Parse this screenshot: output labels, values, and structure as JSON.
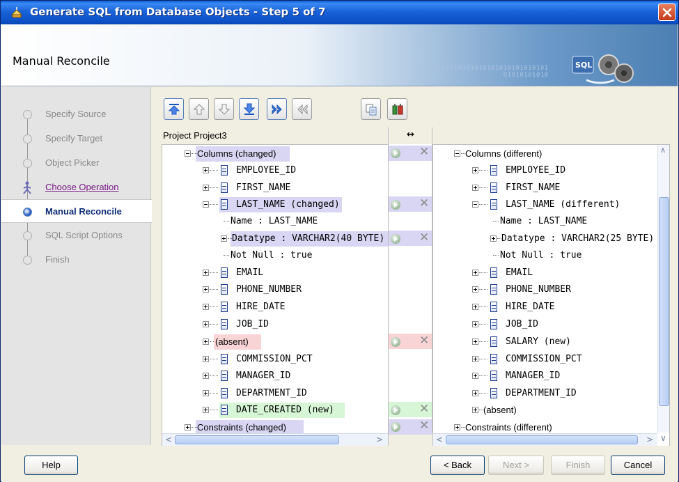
{
  "window": {
    "title": "Generate SQL from Database Objects - Step 5 of 7"
  },
  "header": {
    "heading": "Manual Reconcile",
    "binary_text": "0101010101010101010101010101\n                 01010101010"
  },
  "nav": {
    "items": [
      {
        "label": "Specify Source",
        "state": "done"
      },
      {
        "label": "Specify Target",
        "state": "done"
      },
      {
        "label": "Object Picker",
        "state": "done"
      },
      {
        "label": "Choose Operation",
        "state": "link"
      },
      {
        "label": "Manual Reconcile",
        "state": "active"
      },
      {
        "label": "SQL Script Options",
        "state": "pending"
      },
      {
        "label": "Finish",
        "state": "pending"
      }
    ]
  },
  "toolbar": {
    "buttons": [
      "move-top-icon",
      "move-up-icon",
      "move-down-icon",
      "move-bottom-icon",
      "apply-all-icon",
      "revert-all-icon",
      "copy-icon",
      "compare-icon"
    ]
  },
  "left_tree": {
    "header": "Project Project3",
    "nodes": {
      "columns": "Columns (changed)",
      "employee_id": "EMPLOYEE_ID",
      "first_name": "FIRST_NAME",
      "last_name": "LAST_NAME (changed)",
      "name": "Name : LAST_NAME",
      "datatype": "Datatype : VARCHAR2(40 BYTE) (",
      "not_null": "Not Null : true",
      "email": "EMAIL",
      "phone": "PHONE_NUMBER",
      "hire_date": "HIRE_DATE",
      "job_id": "JOB_ID",
      "absent": "(absent)",
      "commission": "COMMISSION_PCT",
      "manager": "MANAGER_ID",
      "department": "DEPARTMENT_ID",
      "date_created": "DATE_CREATED (new)",
      "constraints": "Constraints (changed)"
    }
  },
  "middle": {
    "header": "↔"
  },
  "right_tree": {
    "nodes": {
      "columns": "Columns (different)",
      "employee_id": "EMPLOYEE_ID",
      "first_name": "FIRST_NAME",
      "last_name": "LAST_NAME (different)",
      "name": "Name : LAST_NAME",
      "datatype": "Datatype : VARCHAR2(25 BYTE) (",
      "not_null": "Not Null : true",
      "email": "EMAIL",
      "phone": "PHONE_NUMBER",
      "hire_date": "HIRE_DATE",
      "job_id": "JOB_ID",
      "salary": "SALARY (new)",
      "commission": "COMMISSION_PCT",
      "manager": "MANAGER_ID",
      "department": "DEPARTMENT_ID",
      "absent": "(absent)",
      "constraints": "Constraints (different)"
    }
  },
  "footer": {
    "help": "Help",
    "back": "< Back",
    "next": "Next >",
    "finish": "Finish",
    "cancel": "Cancel"
  },
  "colors": {
    "changed": "#d8d6f3",
    "absent": "#f9d4d6",
    "new": "#d6f6d6",
    "title_bar": "#1a63d9"
  }
}
